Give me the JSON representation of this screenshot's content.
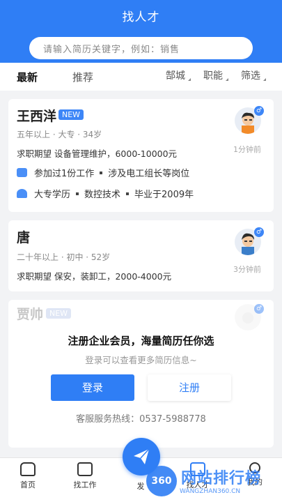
{
  "header": {
    "title": "找人才",
    "search_placeholder": "请输入简历关键字，例如：销售"
  },
  "tabs": {
    "latest": "最新",
    "recommend": "推荐"
  },
  "filters": {
    "city": "郜城",
    "job": "职能",
    "filter": "筛选"
  },
  "candidates": [
    {
      "name": "王西洋",
      "badge": "NEW",
      "meta": "五年以上 · 大专 · 34岁",
      "expect": "求职期望 设备管理维护，6000-10000元",
      "work_a": "参加过1份工作",
      "work_b": "涉及电工组长等岗位",
      "edu_a": "大专学历",
      "edu_b": "数控技术",
      "edu_c": "毕业于2009年",
      "time": "1分钟前",
      "gender": "♂"
    },
    {
      "name": "唐",
      "meta": "二十年以上 · 初中 · 52岁",
      "expect": "求职期望 保安，装卸工，2000-4000元",
      "time": "3分钟前",
      "gender": "♂"
    },
    {
      "name": "贾帅",
      "badge": "NEW",
      "gender": "♂"
    }
  ],
  "login_prompt": {
    "title": "注册企业会员，海量简历任你选",
    "subtitle": "登录可以查看更多简历信息~",
    "login": "登录",
    "register": "注册",
    "hotline": "客服服务热线：0537-5988778"
  },
  "bottom_nav": {
    "home": "首页",
    "find_job": "找工作",
    "post": "发",
    "find_talent": "找人才",
    "me": "我的"
  },
  "watermark": {
    "badge": "360",
    "text": "网站排行榜",
    "url": "WANGZHAN360.CN"
  }
}
